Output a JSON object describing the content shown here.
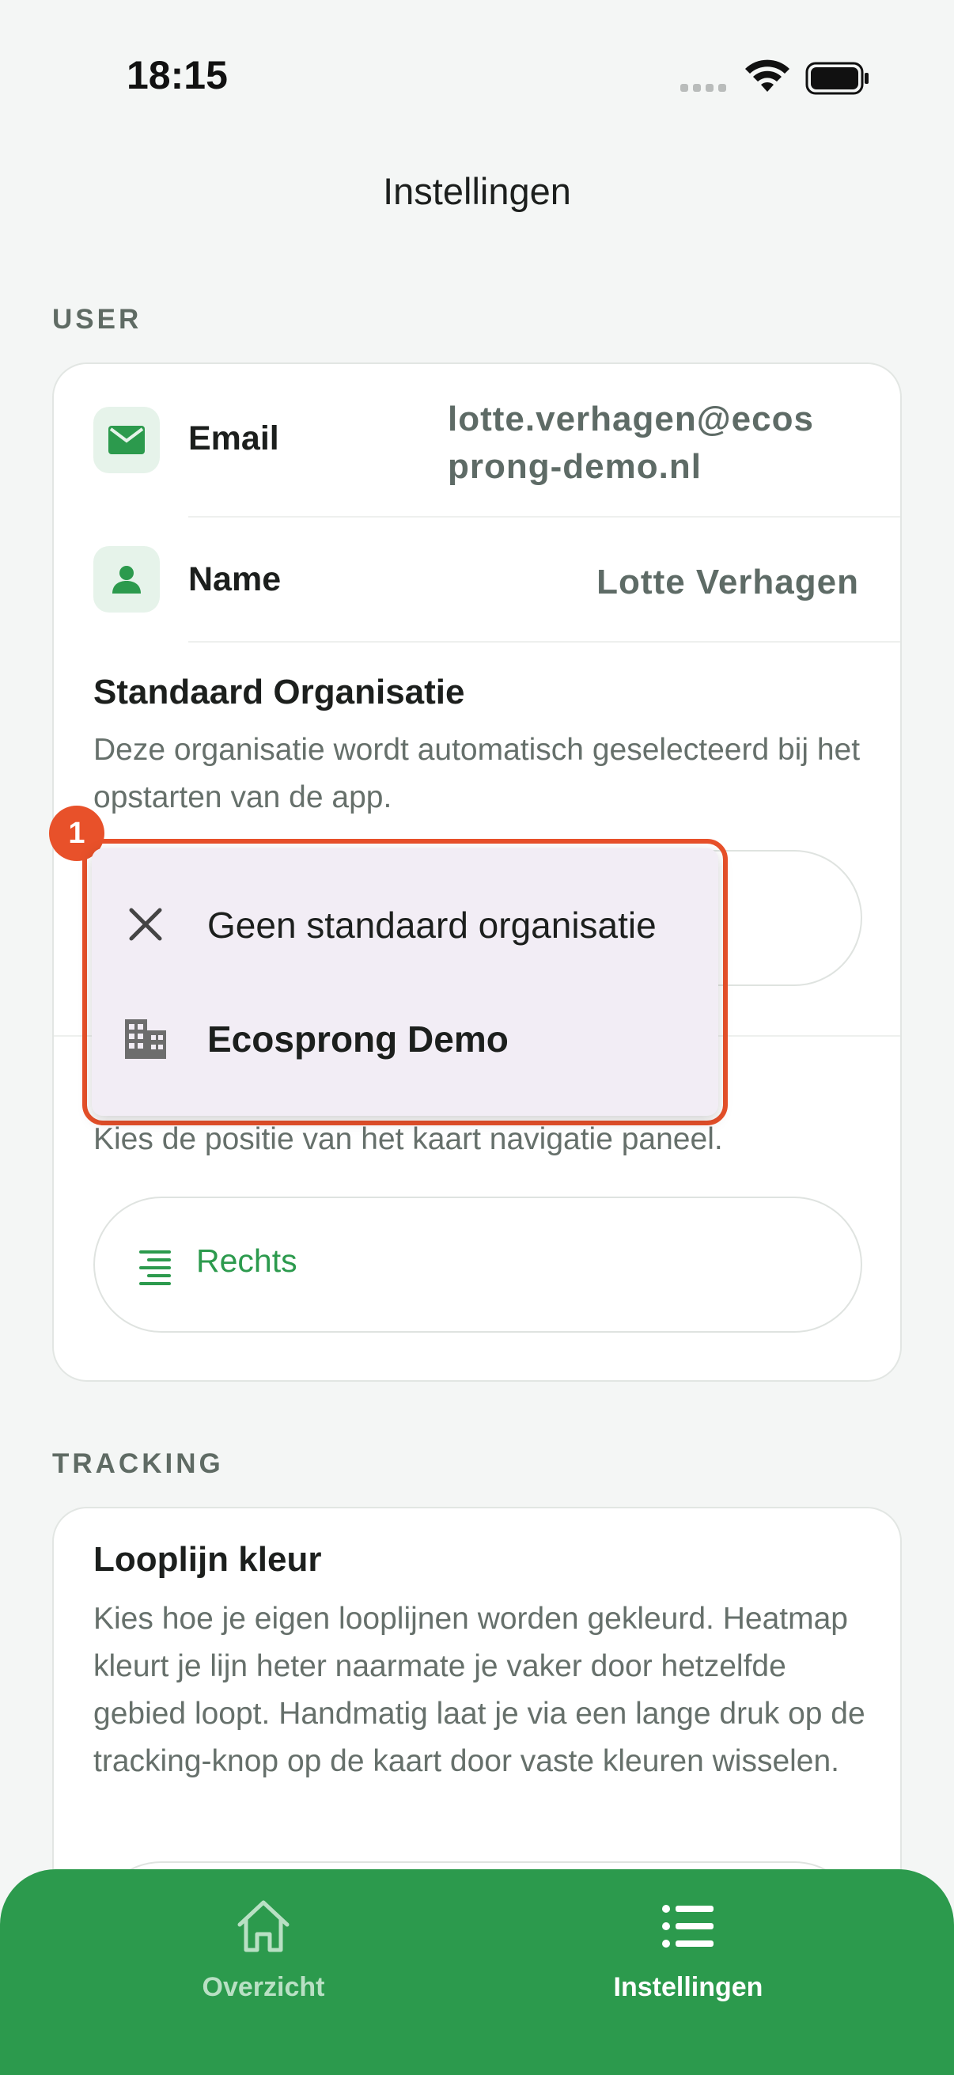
{
  "status": {
    "time": "18:15"
  },
  "header": {
    "title": "Instellingen"
  },
  "colors": {
    "accent": "#2c9a4d",
    "highlight": "#e8512a",
    "menu_bg": "#f2edf5"
  },
  "user_section": {
    "label": "USER",
    "email": {
      "label": "Email",
      "value_line1": "lotte.verhagen@ecos",
      "value_line2": "prong-demo.nl",
      "icon": "mail-icon"
    },
    "name": {
      "label": "Name",
      "value": "Lotte Verhagen",
      "icon": "person-icon"
    },
    "default_org": {
      "title": "Standaard Organisatie",
      "description": "Deze organisatie wordt automatisch geselecteerd bij het opstarten van de app."
    },
    "map_panel": {
      "description": "Kies de positie van het kaart navigatie paneel.",
      "selected": "Rechts",
      "icon": "align-right-icon"
    }
  },
  "dropdown": {
    "badge": "1",
    "items": [
      {
        "label": "Geen standaard organisatie",
        "icon": "close-icon"
      },
      {
        "label": "Ecosprong Demo",
        "icon": "building-icon"
      }
    ]
  },
  "tracking_section": {
    "label": "TRACKING",
    "walk_line": {
      "title": "Looplijn kleur",
      "description": "Kies hoe je eigen looplijnen worden gekleurd. Heatmap kleurt je lijn heter naarmate je vaker door hetzelfde gebied loopt. Handmatig laat je via een lange druk op de tracking-knop op de kaart door vaste kleuren wisselen."
    }
  },
  "tabbar": {
    "tabs": [
      {
        "label": "Overzicht",
        "icon": "home-icon",
        "active": false
      },
      {
        "label": "Instellingen",
        "icon": "list-icon",
        "active": true
      }
    ]
  }
}
